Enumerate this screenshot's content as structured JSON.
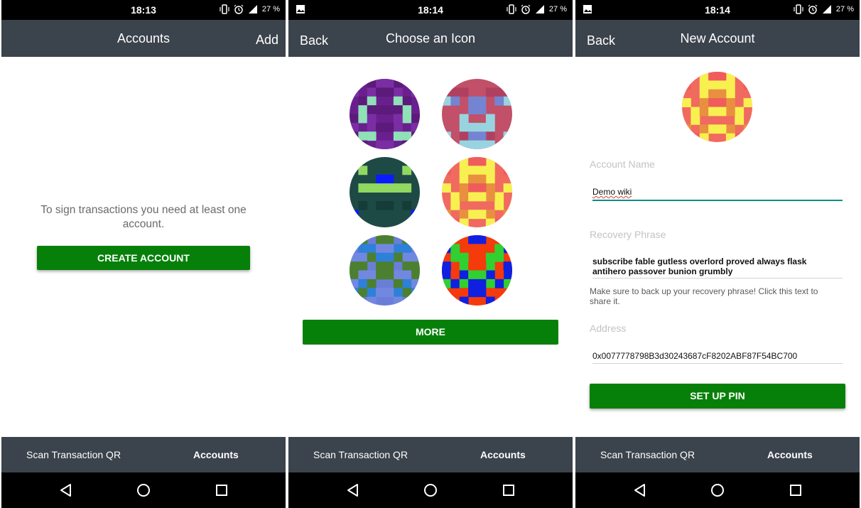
{
  "status": {
    "battery": "27 %",
    "network": "LTE",
    "icons": [
      "vibrate-icon",
      "alarm-icon",
      "lte-signal-icon",
      "image-notification-icon"
    ]
  },
  "tabs": {
    "scan": "Scan Transaction QR",
    "accounts": "Accounts"
  },
  "colors": {
    "appbar": "#3b434c",
    "button": "#068009",
    "accent_underline": "#0e8c84"
  },
  "screen1": {
    "time": "18:13",
    "title": "Accounts",
    "add": "Add",
    "message": "To sign transactions you need at least one account.",
    "create_button": "CREATE ACCOUNT"
  },
  "screen2": {
    "time": "18:14",
    "back": "Back",
    "title": "Choose an Icon",
    "more_button": "MORE",
    "icons": [
      {
        "name": "identicon-purple",
        "bg": "#6a1f8e",
        "colors": [
          "#7b2ea4",
          "#5c1a7a",
          "#90e0b8"
        ],
        "seed": 11
      },
      {
        "name": "identicon-rose-blue",
        "bg": "#c15068",
        "colors": [
          "#7484d0",
          "#98d4e0",
          "#b04060"
        ],
        "seed": 23
      },
      {
        "name": "identicon-teal-green",
        "bg": "#1e4a46",
        "colors": [
          "#0a1cff",
          "#90d860",
          "#163c38"
        ],
        "seed": 37
      },
      {
        "name": "identicon-orange-yellow",
        "bg": "#f06a60",
        "colors": [
          "#f8f050",
          "#e89040",
          "#f05c5c"
        ],
        "seed": 41
      },
      {
        "name": "identicon-blue-olive",
        "bg": "#6a7ed8",
        "colors": [
          "#4c8030",
          "#2e80d8",
          "#7288e0"
        ],
        "seed": 53
      },
      {
        "name": "identicon-red-multi",
        "bg": "#f53a0c",
        "colors": [
          "#1020e0",
          "#30d030",
          "#f53a0c"
        ],
        "seed": 67
      }
    ]
  },
  "screen3": {
    "time": "18:14",
    "back": "Back",
    "title": "New Account",
    "avatar_icon": {
      "name": "identicon-orange-yellow",
      "bg": "#f06a60",
      "colors": [
        "#f8f050",
        "#e89040",
        "#f05c5c"
      ],
      "seed": 41
    },
    "account_name_label": "Account Name",
    "account_name_value": "Demo wiki",
    "recovery_label": "Recovery Phrase",
    "recovery_value": "subscribe fable gutless overlord proved always flask antihero passover bunion grumbly",
    "recovery_hint": "Make sure to back up your recovery phrase! Click this text to share it.",
    "address_label": "Address",
    "address_value": "0x0077778798B3d30243687cF8202ABF87F54BC700",
    "setup_pin_button": "SET UP PIN"
  }
}
